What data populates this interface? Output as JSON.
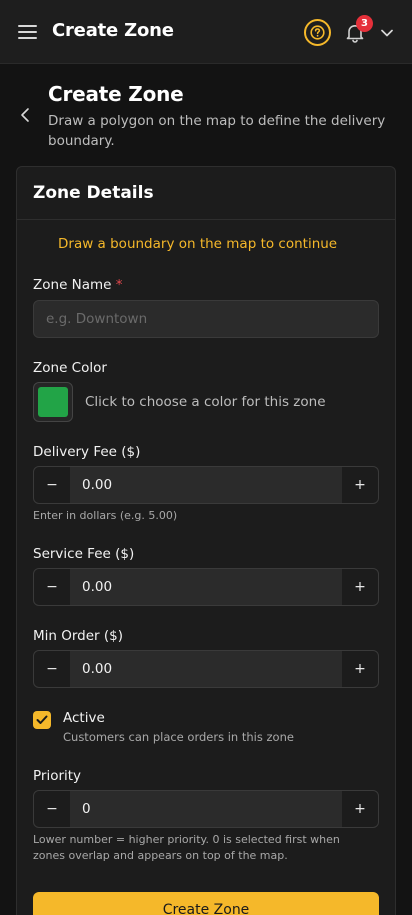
{
  "topbar": {
    "title": "Create Zone",
    "notification_count": "3"
  },
  "header": {
    "title": "Create Zone",
    "subtitle": "Draw a polygon on the map to define the delivery boundary."
  },
  "card": {
    "title": "Zone Details",
    "warning": "Draw a boundary on the map to continue"
  },
  "form": {
    "zone_name": {
      "label": "Zone Name",
      "required_marker": "*",
      "value": "",
      "placeholder": "e.g. Downtown"
    },
    "zone_color": {
      "label": "Zone Color",
      "hint": "Click to choose a color for this zone",
      "color": "#22a447"
    },
    "delivery_fee": {
      "label": "Delivery Fee ($)",
      "value": "0.00",
      "help": "Enter in dollars (e.g. 5.00)"
    },
    "service_fee": {
      "label": "Service Fee ($)",
      "value": "0.00"
    },
    "min_order": {
      "label": "Min Order ($)",
      "value": "0.00"
    },
    "active": {
      "label": "Active",
      "description": "Customers can place orders in this zone",
      "checked": true
    },
    "priority": {
      "label": "Priority",
      "value": "0",
      "help": "Lower number = higher priority. 0 is selected first when zones overlap and appears on top of the map."
    },
    "stepper_minus": "−",
    "stepper_plus": "+",
    "submit_label": "Create Zone"
  },
  "colors": {
    "accent": "#f5b82a",
    "danger": "#e5303a",
    "background": "#131313"
  },
  "icons": [
    "menu-icon",
    "help-icon",
    "bell-icon",
    "chevron-down-icon",
    "back-icon",
    "check-icon"
  ]
}
